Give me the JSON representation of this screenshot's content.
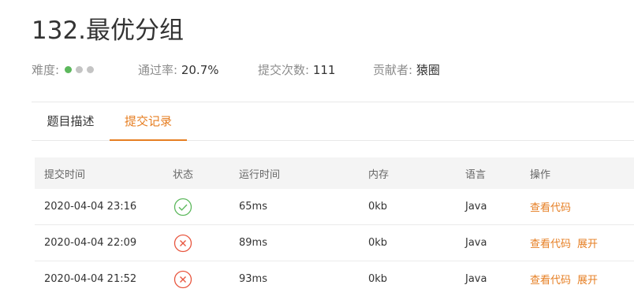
{
  "problem": {
    "title": "132.最优分组",
    "difficulty_label": "难度:",
    "difficulty_dots": [
      "#5cb85c",
      "#c4c4c4",
      "#c4c4c4"
    ],
    "pass_rate_label": "通过率:",
    "pass_rate": "20.7%",
    "submissions_label": "提交次数:",
    "submissions": "111",
    "contributor_label": "贡献者:",
    "contributor": "猿圈"
  },
  "tabs": [
    {
      "label": "题目描述",
      "active": false
    },
    {
      "label": "提交记录",
      "active": true
    }
  ],
  "table": {
    "headers": {
      "time": "提交时间",
      "status": "状态",
      "runtime": "运行时间",
      "memory": "内存",
      "language": "语言",
      "actions": "操作"
    },
    "rows": [
      {
        "time": "2020-04-04 23:16",
        "status": "accepted",
        "runtime": "65ms",
        "memory": "0kb",
        "language": "Java",
        "view_code": "查看代码"
      },
      {
        "time": "2020-04-04 22:09",
        "status": "failed",
        "runtime": "89ms",
        "memory": "0kb",
        "language": "Java",
        "view_code": "查看代码",
        "expand": "展开"
      },
      {
        "time": "2020-04-04 21:52",
        "status": "failed",
        "runtime": "93ms",
        "memory": "0kb",
        "language": "Java",
        "view_code": "查看代码",
        "expand": "展开"
      }
    ]
  },
  "colors": {
    "accent": "#e67e22",
    "success": "#5cb85c",
    "error": "#e8553e"
  }
}
